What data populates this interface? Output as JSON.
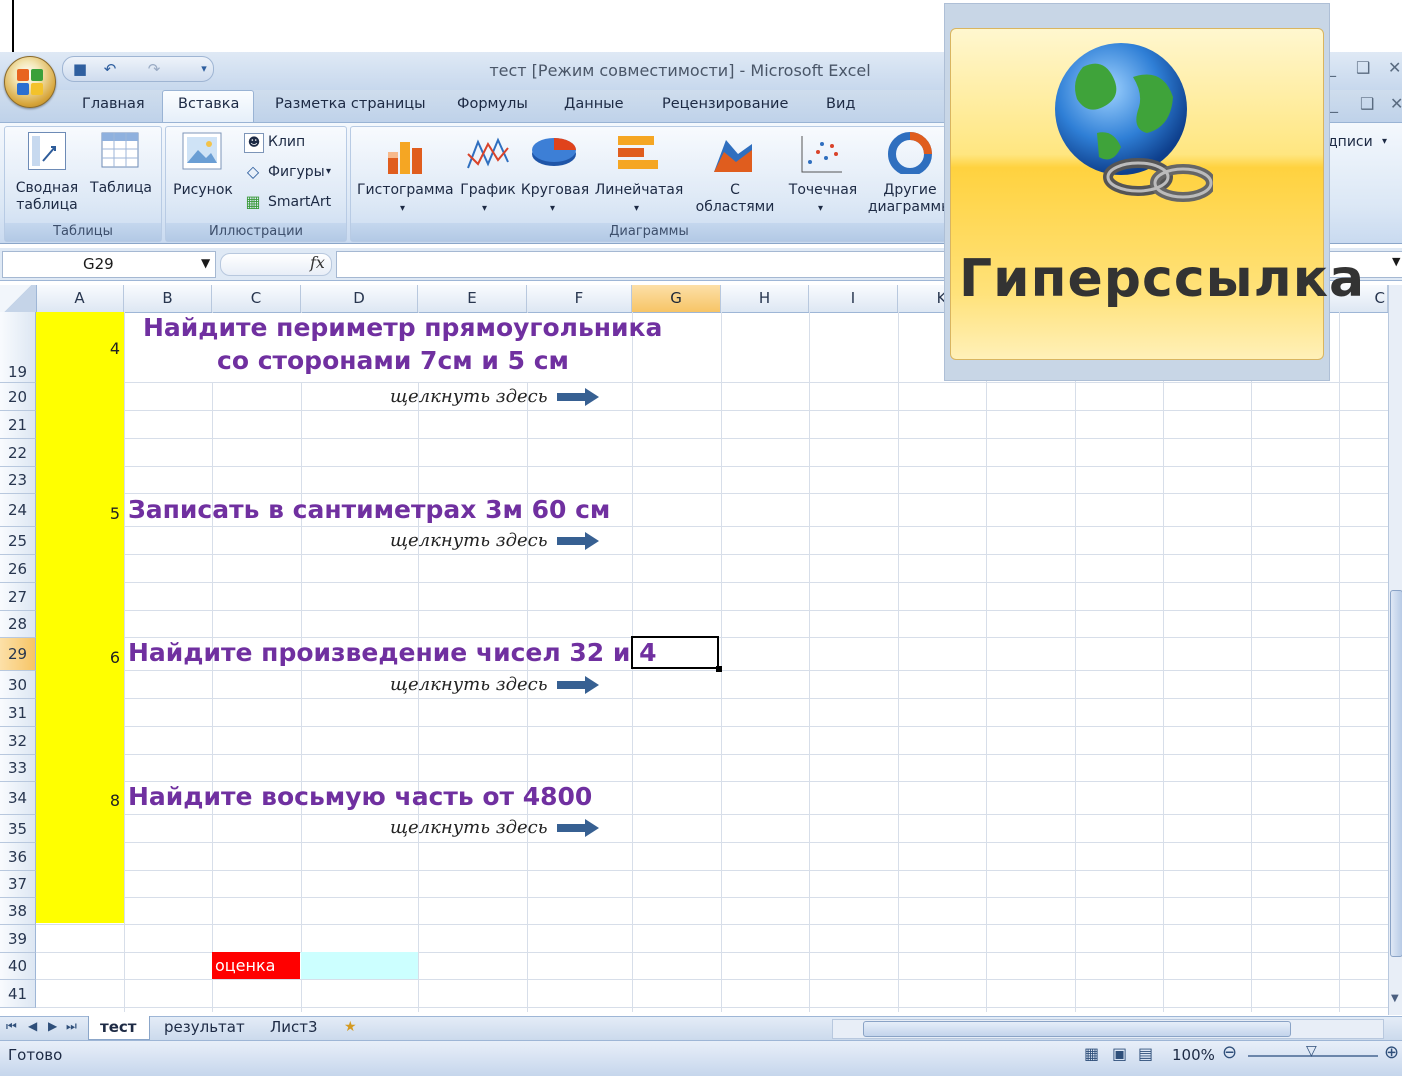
{
  "window": {
    "title": "тест  [Режим совместимости]  -  Microsoft Excel"
  },
  "tabs": [
    "Главная",
    "Вставка",
    "Разметка страницы",
    "Формулы",
    "Данные",
    "Рецензирование",
    "Вид"
  ],
  "active_tab": "Вставка",
  "ribbon": {
    "tables": {
      "label": "Таблицы",
      "pivot": "Сводная\nтаблица",
      "table": "Таблица"
    },
    "illustrations": {
      "label": "Иллюстрации",
      "picture": "Рисунок",
      "clip": "Клип",
      "shapes": "Фигуры",
      "smartart": "SmartArt"
    },
    "charts": {
      "label": "Диаграммы",
      "column": "Гистограмма",
      "line": "График",
      "pie": "Круговая",
      "bar": "Линейчатая",
      "area": "С\nобластями",
      "scatter": "Точечная",
      "other": "Другие\nдиаграммы"
    },
    "partial_right": "дписи"
  },
  "formula_bar": {
    "name_box": "G29",
    "fx": "fx",
    "content": ""
  },
  "columns": [
    "A",
    "B",
    "C",
    "D",
    "E",
    "F",
    "G",
    "H",
    "I",
    "K",
    "C"
  ],
  "rows": [
    "19",
    "20",
    "21",
    "22",
    "23",
    "24",
    "25",
    "26",
    "27",
    "28",
    "29",
    "30",
    "31",
    "32",
    "33",
    "34",
    "35",
    "36",
    "37",
    "38",
    "39",
    "40",
    "41"
  ],
  "selected_cell": "G29",
  "tasks": [
    {
      "number": "4",
      "text_line1": "Найдите периметр прямоугольника",
      "text_line2": "со сторонами 7см и 5 см",
      "link": "щелкнуть здесь"
    },
    {
      "number": "5",
      "text_line1": "Записать в сантиметрах 3м 60 см",
      "link": "щелкнуть здесь"
    },
    {
      "number": "6",
      "text_line1": "Найдите произведение чисел 32 и 4",
      "link": "щелкнуть здесь"
    },
    {
      "number": "8",
      "text_line1": "Найдите восьмую часть от 4800",
      "link": "щелкнуть здесь"
    }
  ],
  "grade_label": "оценка",
  "sheet_tabs": [
    "тест",
    "результат",
    "Лист3"
  ],
  "status": {
    "ready": "Готово",
    "zoom": "100%"
  },
  "hyperlink_popup": {
    "label": "Гиперссылка",
    "icon": "globe-link-icon"
  },
  "colors": {
    "yellow": "#ffff00",
    "task_text": "#7030a0",
    "grade_red": "#ff0000",
    "grade_cyan": "#ccffff",
    "arrow": "#376092"
  }
}
